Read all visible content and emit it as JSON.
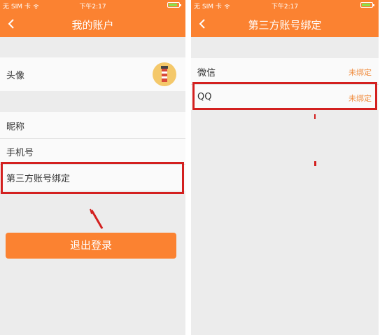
{
  "screens": {
    "account": {
      "status": {
        "carrier": "无 SIM 卡",
        "time": "下午2:17"
      },
      "title": "我的账户",
      "rows": {
        "avatar": "头像",
        "nickname": "昵称",
        "phone": "手机号",
        "third_party": "第三方账号绑定"
      },
      "logout_label": "退出登录"
    },
    "binding": {
      "status": {
        "carrier": "无 SIM 卡",
        "time": "下午2:17"
      },
      "title": "第三方账号绑定",
      "items": [
        {
          "name": "微信",
          "status": "未绑定"
        },
        {
          "name": "QQ",
          "status": "未绑定"
        }
      ]
    }
  },
  "colors": {
    "accent": "#fb8231",
    "highlight": "#d3201f",
    "status_text": "#f08b3c"
  },
  "icons": {
    "back": "chevron-left-icon",
    "wifi": "wifi-icon",
    "battery": "battery-icon"
  }
}
